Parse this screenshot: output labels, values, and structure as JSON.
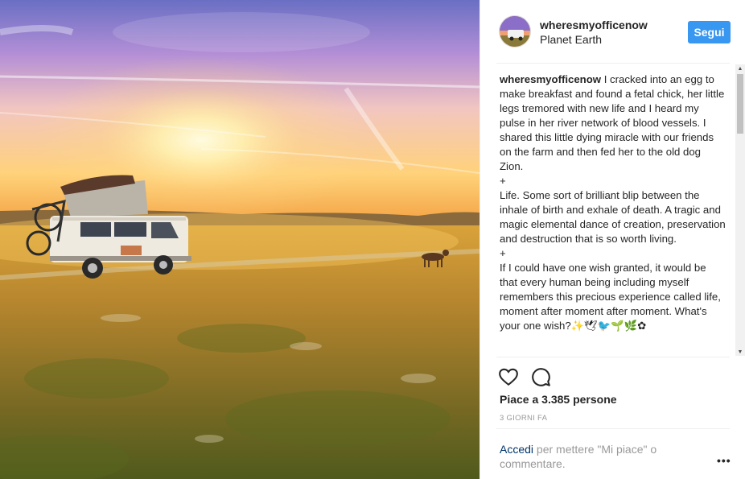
{
  "post": {
    "username": "wheresmyofficenow",
    "location": "Planet Earth",
    "follow_label": "Segui",
    "caption_username": "wheresmyofficenow",
    "caption_lines": [
      "I cracked into an egg to make breakfast and found a fetal chick, her little legs tremored with new life and I heard my pulse in her river network of blood vessels. I shared this little dying miracle with our friends on the farm and then fed her to the old dog Zion.",
      "+",
      "Life. Some sort of brilliant blip between the inhale of birth and exhale of death. A tragic and magic elemental dance of creation, preservation and destruction that is so worth living.",
      "+",
      "If I could have one wish granted, it would be that every human being including myself remembers this precious experience called life, moment after moment after moment. What's your one wish?✨🕊🐦🌱🌿✿"
    ],
    "likes_text": "Piace a 3.385 persone",
    "timestamp": "3 GIORNI FA",
    "login_link": "Accedi",
    "login_rest": " per mettere \"Mi piace\" o commentare.",
    "icons": {
      "like": "heart-icon",
      "comment": "comment-icon",
      "more": "more-options-icon"
    },
    "colors": {
      "follow_button": "#3897f0",
      "link": "#003569",
      "muted": "#999999"
    }
  }
}
